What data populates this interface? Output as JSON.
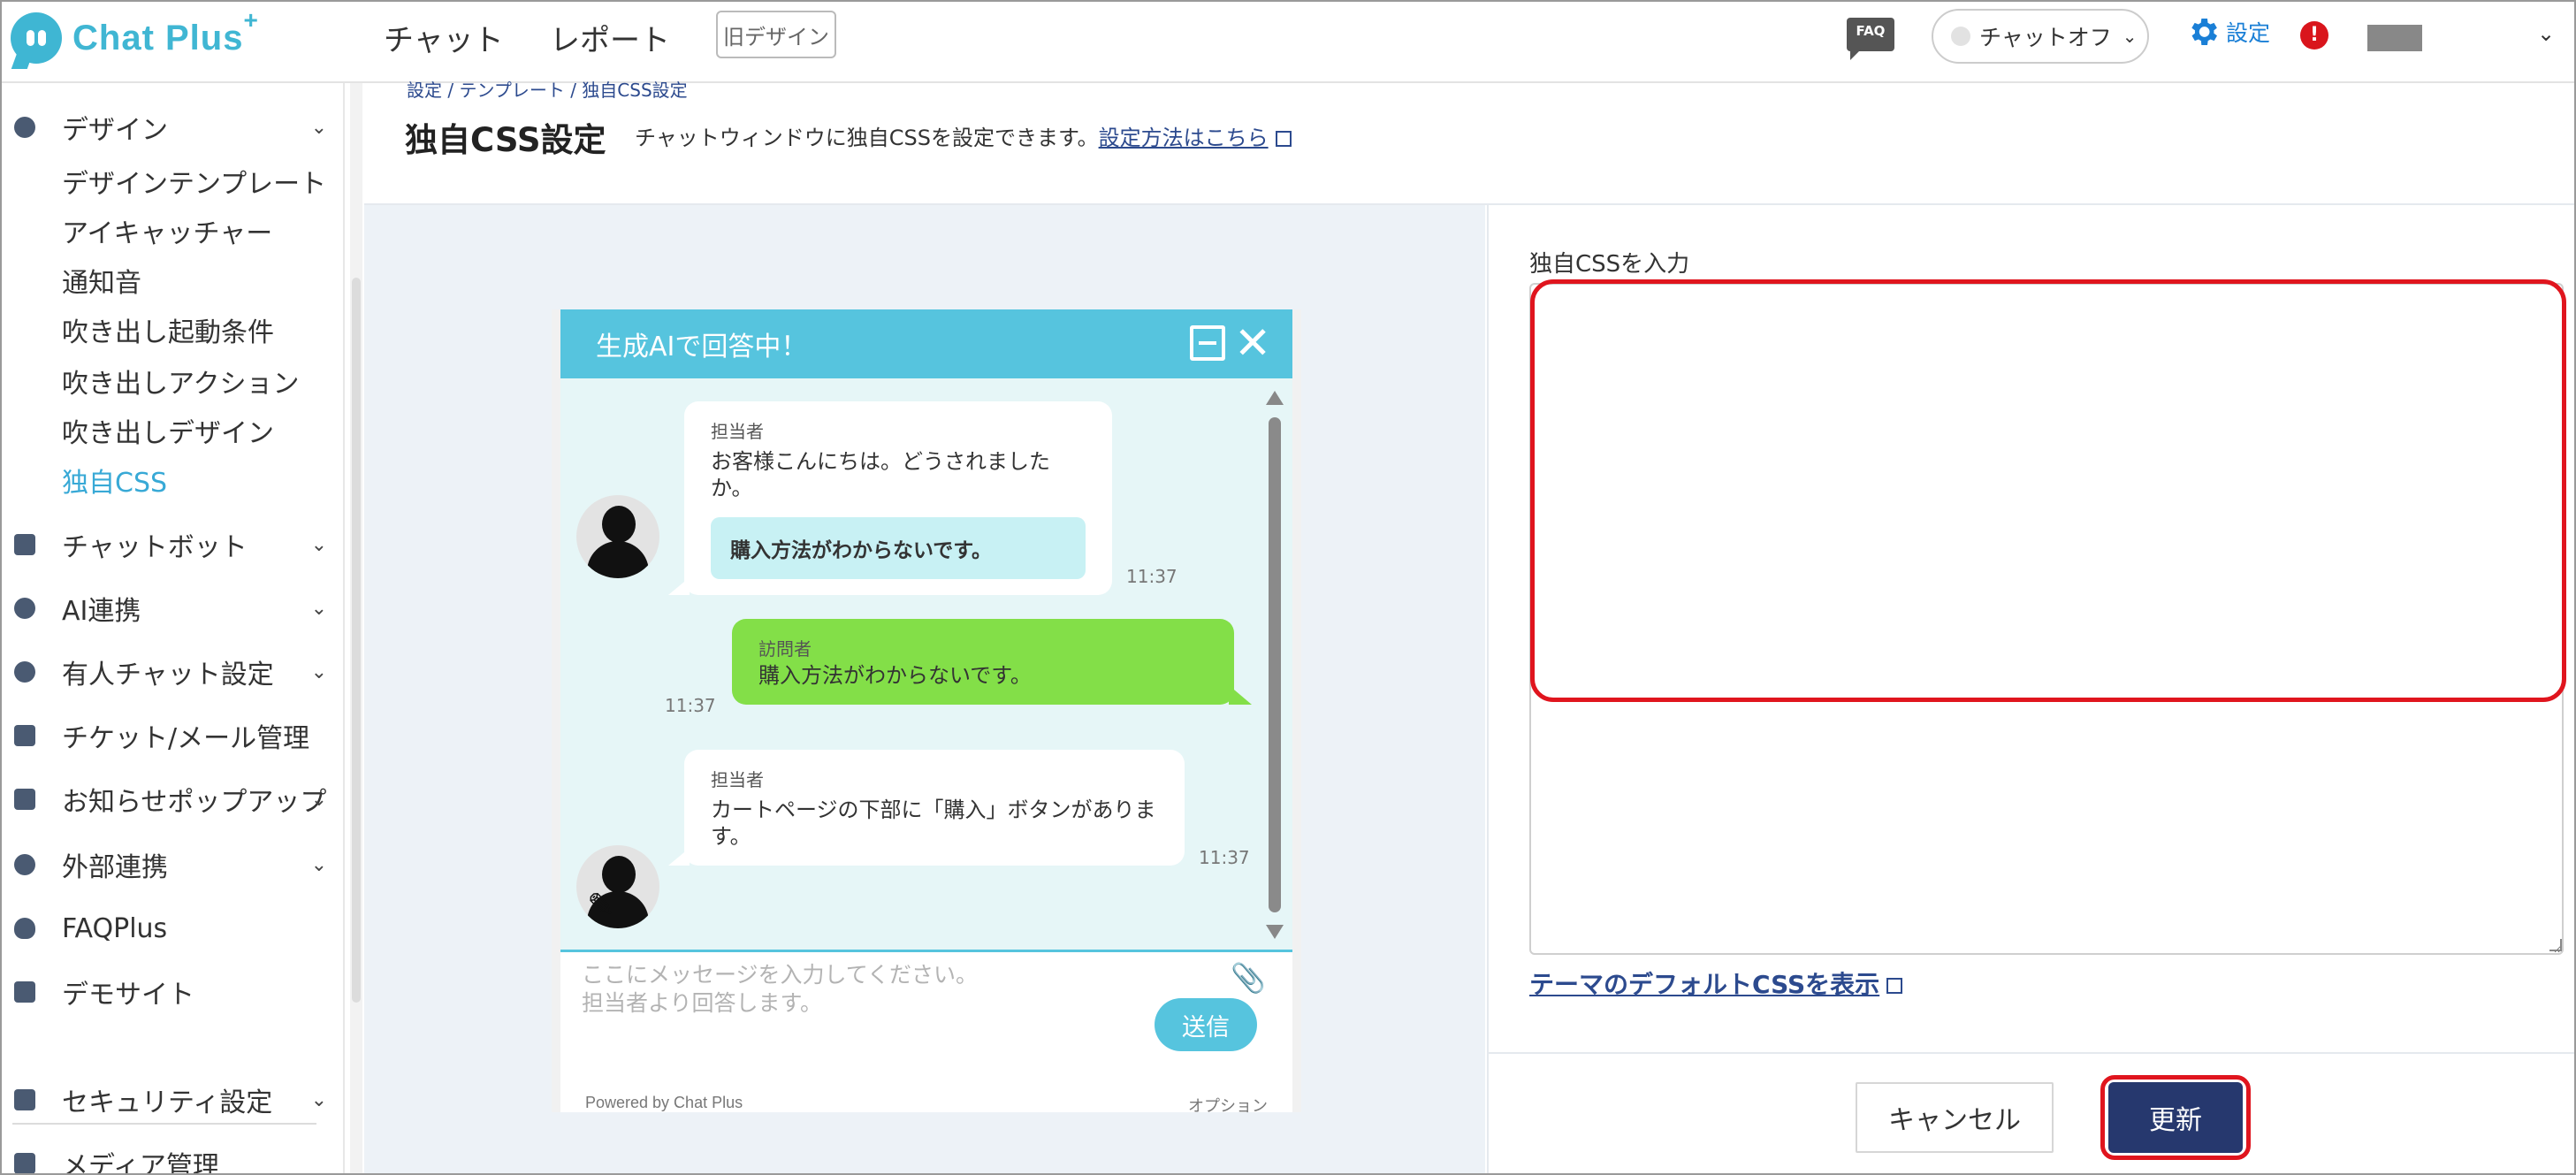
{
  "header": {
    "logo_text": "Chat Plus",
    "logo_plus": "+",
    "nav": [
      "チャット",
      "レポート"
    ],
    "old_design": "旧デザイン",
    "faq": "FAQ",
    "chat_status": "チャットオフ",
    "settings": "設定",
    "alert": "!",
    "user_chevron": "⌄"
  },
  "sidebar": {
    "design": {
      "label": "デザイン",
      "chevron": "⌄"
    },
    "design_items": [
      "デザインテンプレート",
      "アイキャッチャー",
      "通知音",
      "吹き出し起動条件",
      "吹き出しアクション",
      "吹き出しデザイン",
      "独自CSS"
    ],
    "sections": [
      {
        "label": "チャットボット",
        "chevron": "⌄"
      },
      {
        "label": "AI連携",
        "chevron": "⌄"
      },
      {
        "label": "有人チャット設定",
        "chevron": "⌄"
      },
      {
        "label": "チケット/メール管理",
        "chevron": ""
      },
      {
        "label": "お知らせポップアップ",
        "chevron": "⌄"
      },
      {
        "label": "外部連携",
        "chevron": "⌄"
      },
      {
        "label": "FAQPlus",
        "chevron": ""
      },
      {
        "label": "デモサイト",
        "chevron": ""
      },
      {
        "label": "セキュリティ設定",
        "chevron": "⌄"
      },
      {
        "label": "メディア管理",
        "chevron": ""
      }
    ]
  },
  "page": {
    "breadcrumb": "設定 / テンプレート / 独自CSS設定",
    "title": "独自CSS設定",
    "description": "チャットウィンドウに独自CSSを設定できます。",
    "how_to_link": "設定方法はこちら"
  },
  "widget": {
    "title": "生成AIで回答中！",
    "close": "✕",
    "messages": [
      {
        "who": "担当者",
        "text": "お客様こんにちは。どうされましたか。",
        "quick_reply": "購入方法がわからないです。",
        "time": "11:37"
      },
      {
        "who": "訪問者",
        "text": "購入方法がわからないです。",
        "time": "11:37"
      },
      {
        "who": "担当者",
        "text": "カートページの下部に「購入」ボタンがあります。",
        "time": "11:37"
      }
    ],
    "placeholder_line1": "ここにメッセージを入力してください。",
    "placeholder_line2": "担当者より回答します。",
    "clip": "📎",
    "pen": "✎",
    "send": "送信",
    "powered": "Powered by Chat Plus",
    "option": "オプション"
  },
  "css_editor": {
    "label": "独自CSSを入力",
    "value": "",
    "default_link": "テーマのデフォルトCSSを表示"
  },
  "footer": {
    "cancel": "キャンセル",
    "update": "更新"
  },
  "colors": {
    "accent": "#38a9d6",
    "widget_header": "#56c4de",
    "visitor_bubble": "#83df48",
    "primary_button": "#26386e",
    "highlight": "#e0151e"
  }
}
